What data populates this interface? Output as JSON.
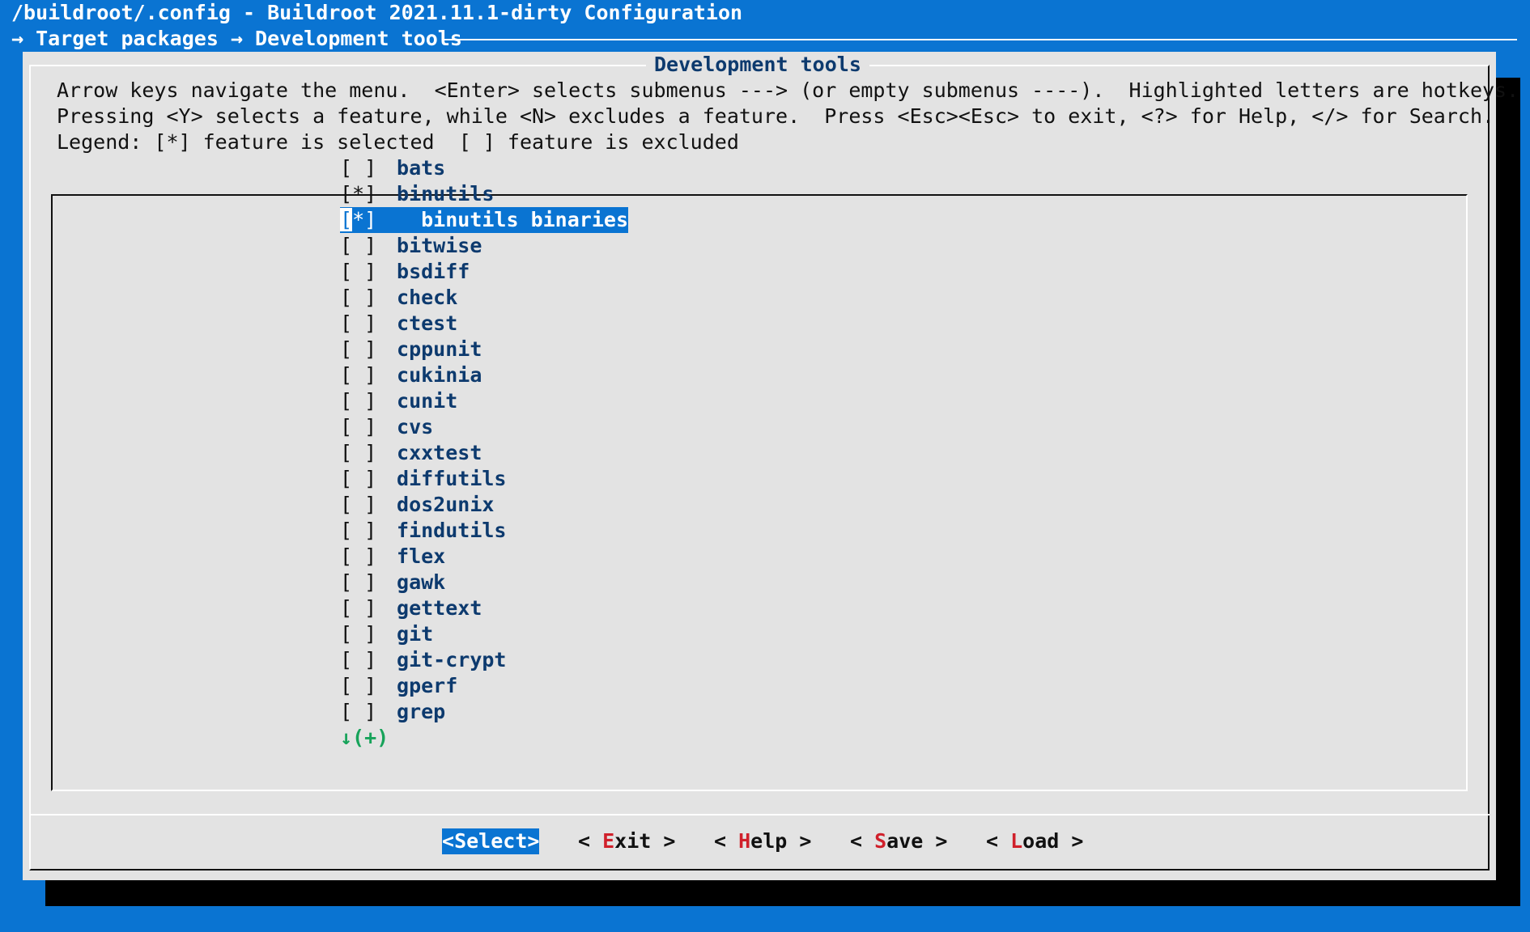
{
  "window": {
    "title": "/buildroot/.config - Buildroot 2021.11.1-dirty Configuration",
    "breadcrumb": "→ Target packages → Development tools"
  },
  "dialog": {
    "title": "Development tools",
    "help_lines": [
      "Arrow keys navigate the menu.  <Enter> selects submenus ---> (or empty submenus ----).  Highlighted letters are hotkeys.",
      "Pressing <Y> selects a feature, while <N> excludes a feature.  Press <Esc><Esc> to exit, <?> for Help, </> for Search.",
      "Legend: [*] feature is selected  [ ] feature is excluded"
    ]
  },
  "menu": {
    "items": [
      {
        "check": "[ ]",
        "hot": "b",
        "rest": "ats",
        "selected": false
      },
      {
        "check": "[*]",
        "hot": "b",
        "rest": "inutils",
        "selected": false
      },
      {
        "check": "[*]",
        "hot": "b",
        "rest": "inutils binaries",
        "indent": "  ",
        "selected": true
      },
      {
        "check": "[ ]",
        "hot": "b",
        "rest": "itwise",
        "selected": false
      },
      {
        "check": "[ ]",
        "hot": "b",
        "rest": "sdiff",
        "selected": false
      },
      {
        "check": "[ ]",
        "hot": "c",
        "rest": "heck",
        "selected": false
      },
      {
        "check": "[ ]",
        "hot": "c",
        "rest": "test",
        "selected": false
      },
      {
        "check": "[ ]",
        "hot": "c",
        "rest": "ppunit",
        "selected": false
      },
      {
        "check": "[ ]",
        "hot": "c",
        "rest": "ukinia",
        "selected": false
      },
      {
        "check": "[ ]",
        "hot": "c",
        "rest": "unit",
        "selected": false
      },
      {
        "check": "[ ]",
        "hot": "c",
        "rest": "vs",
        "selected": false
      },
      {
        "check": "[ ]",
        "hot": "c",
        "rest": "xxtest",
        "selected": false
      },
      {
        "check": "[ ]",
        "hot": "d",
        "rest": "iffutils",
        "selected": false
      },
      {
        "check": "[ ]",
        "hot": "d",
        "rest": "os2unix",
        "selected": false
      },
      {
        "check": "[ ]",
        "hot": "f",
        "rest": "indutils",
        "selected": false
      },
      {
        "check": "[ ]",
        "hot": "f",
        "rest": "lex",
        "selected": false
      },
      {
        "check": "[ ]",
        "hot": "g",
        "rest": "awk",
        "selected": false
      },
      {
        "check": "[ ]",
        "hot": "g",
        "rest": "ettext",
        "selected": false
      },
      {
        "check": "[ ]",
        "hot": "g",
        "rest": "it",
        "selected": false
      },
      {
        "check": "[ ]",
        "hot": "g",
        "rest": "it-crypt",
        "selected": false
      },
      {
        "check": "[ ]",
        "hot": "g",
        "rest": "perf",
        "selected": false
      },
      {
        "check": "[ ]",
        "hot": "g",
        "rest": "rep",
        "selected": false
      }
    ],
    "more_indicator": "↓(+)"
  },
  "buttons": [
    {
      "name": "select",
      "pre": "<",
      "hot": "S",
      "rest": "elect",
      "post": ">",
      "active": true
    },
    {
      "name": "exit",
      "pre": "< ",
      "hot": "E",
      "rest": "xit",
      "post": " >",
      "active": false
    },
    {
      "name": "help",
      "pre": "< ",
      "hot": "H",
      "rest": "elp",
      "post": " >",
      "active": false
    },
    {
      "name": "save",
      "pre": "< ",
      "hot": "S",
      "rest": "ave",
      "post": " >",
      "active": false
    },
    {
      "name": "load",
      "pre": "< ",
      "hot": "L",
      "rest": "oad",
      "post": " >",
      "active": false
    }
  ],
  "colors": {
    "background": "#0a74d2",
    "dialog": "#e3e3e3",
    "hotkey_label": "#0d3a6e",
    "button_hotkey": "#d0202b",
    "more_indicator": "#17a35a"
  }
}
